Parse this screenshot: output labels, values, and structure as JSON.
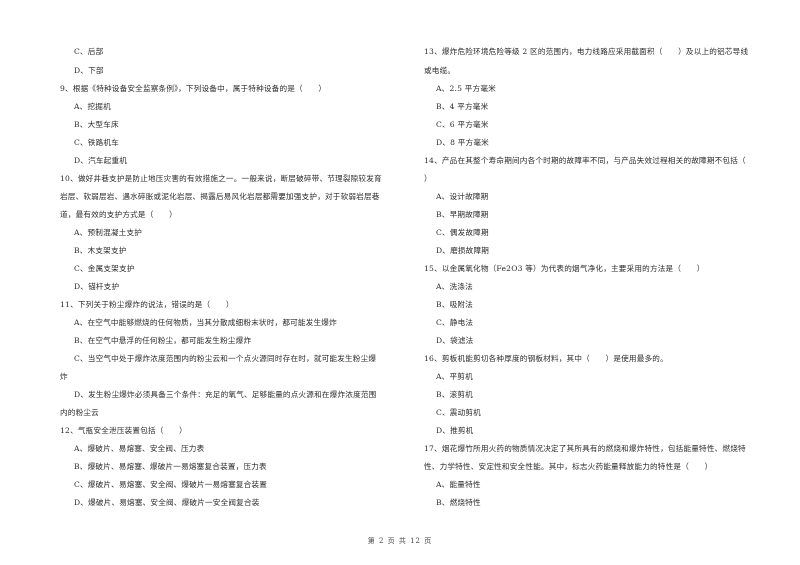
{
  "page": {
    "footer": "第 2 页 共 12 页"
  },
  "left": {
    "q8_tail": {
      "options": [
        "C、后部",
        "D、下部"
      ]
    },
    "q9": {
      "stem": "9、根据《特种设备安全监察条例》，下列设备中，属于特种设备的是（　　）",
      "options": [
        "A、挖掘机",
        "B、大型车床",
        "C、铁路机车",
        "D、汽车起重机"
      ]
    },
    "q10": {
      "stem_lines": [
        "10、做好井巷支护是防止地压灾害的有效措施之一。一般来说，断层破碎带、节理裂隙较发育",
        "岩层、软弱层岩、遇水碎胀或泥化岩层、揭露后易风化岩层都需要加强支护，对于软弱岩层巷",
        "道，最有效的支护方式是（　　）"
      ],
      "options": [
        "A、预制混凝土支护",
        "B、木支架支护",
        "C、金属支架支护",
        "D、锚杆支护"
      ]
    },
    "q11": {
      "stem": "11、下列关于粉尘爆炸的说法，错误的是（　　）",
      "option_lines": [
        "A、在空气中能够燃烧的任何物质，当其分散成细粉末状时，都可能发生爆炸",
        "B、在空气中悬浮的任何粉尘，都可能发生粉尘爆炸",
        "C、当空气中处于爆炸浓度范围内的粉尘云和一个点火源同时存在时，就可能发生粉尘爆",
        "炸",
        "D、发生粉尘爆炸必须具备三个条件：充足的氧气、足够能量的点火源和在爆炸浓度范围",
        "内的粉尘云"
      ]
    },
    "q12": {
      "stem": "12、气瓶安全泄压装置包括（　　）",
      "options": [
        "A、爆破片、易熔塞、安全阀、压力表",
        "B、爆破片、易熔塞、爆破片一易熔塞复合装置，压力表",
        "C、爆破片、易熔塞、安全阀、爆破片一易熔塞复合装置",
        "D、爆破片、易熔塞、安全阀、爆破片一安全阀复合装"
      ]
    }
  },
  "right": {
    "q13": {
      "stem_lines": [
        "13、爆炸危险环境危险等级 2 区的范围内，电力线路应采用截面积（　　）及以上的铝芯导线",
        "或电缆。"
      ],
      "options": [
        "A、2.5 平方毫米",
        "B、4 平方毫米",
        "C、6 平方毫米",
        "D、8 平方毫米"
      ]
    },
    "q14": {
      "stem_lines": [
        "14、产品在其整个寿命期间内各个时期的故障率不同，与产品失效过程相关的故障期不包括（",
        "）"
      ],
      "options": [
        "A、设计故障期",
        "B、早期故障期",
        "C、偶发故障期",
        "D、磨损故障期"
      ]
    },
    "q15": {
      "stem": "15、以金属氧化物（Fe2O3 等）为代表的烟气净化，主要采用的方法是（　　）",
      "options": [
        "A、洗涤法",
        "B、吸附法",
        "C、静电法",
        "D、袋滤法"
      ]
    },
    "q16": {
      "stem": "16、剪板机能剪切各种厚度的钢板材料，其中（　　）是使用最多的。",
      "options": [
        "A、平剪机",
        "B、滚剪机",
        "C、震动剪机",
        "D、推剪机"
      ]
    },
    "q17": {
      "stem_lines": [
        "17、烟花爆竹所用火药的物质情况决定了其所具有的燃烧和爆炸特性，包括能量特性、燃烧特",
        "性、力学特性、安定性和安全性能。其中，标志火药能量释放能力的特性是（　　）"
      ],
      "options": [
        "A、能量特性",
        "B、燃烧特性"
      ]
    }
  }
}
